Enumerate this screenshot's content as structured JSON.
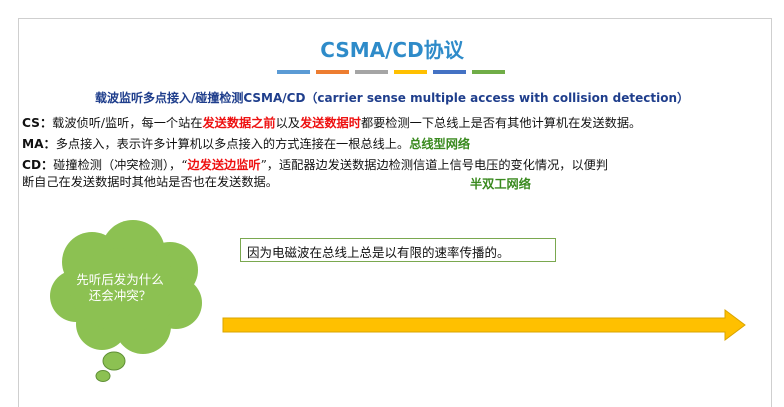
{
  "title": "CSMA/CD协议",
  "accent_colors": [
    "#5b9bd5",
    "#ed7d31",
    "#a5a5a5",
    "#ffc000",
    "#4472c4",
    "#70ad47"
  ],
  "subtitle": {
    "cn": "载波监听多点接入/碰撞检测",
    "en": "CSMA/CD（carrier sense multiple access with collision detection）"
  },
  "cs": {
    "term": "CS：",
    "text1": "载波侦听/监听，每一个站在",
    "red1": "发送数据之前",
    "text2": "以及",
    "red2": "发送数据时",
    "text3": "都要检测一下总线上是否有其他计算机在发送数据。"
  },
  "ma": {
    "term": "MA：",
    "text": "多点接入，表示许多计算机以多点接入的方式连接在一根总线上。",
    "green": "总线型网络"
  },
  "cd": {
    "term": "CD：",
    "text1": "碰撞检测（冲突检测），“",
    "red": "边发送边监听",
    "text2": "”，适配器边发送数据边检测信道上信号电压的变化情况，以便判",
    "line2": "断自己在发送数据时其他站是否也在发送数据。",
    "green": "半双工网络"
  },
  "thought_bubble": {
    "line1": "先听后发为什么",
    "line2": "还会冲突？",
    "fill": "#8cc152"
  },
  "note": "因为电磁波在总线上总是以有限的速率传播的。",
  "arrow_color": "#ffc000"
}
